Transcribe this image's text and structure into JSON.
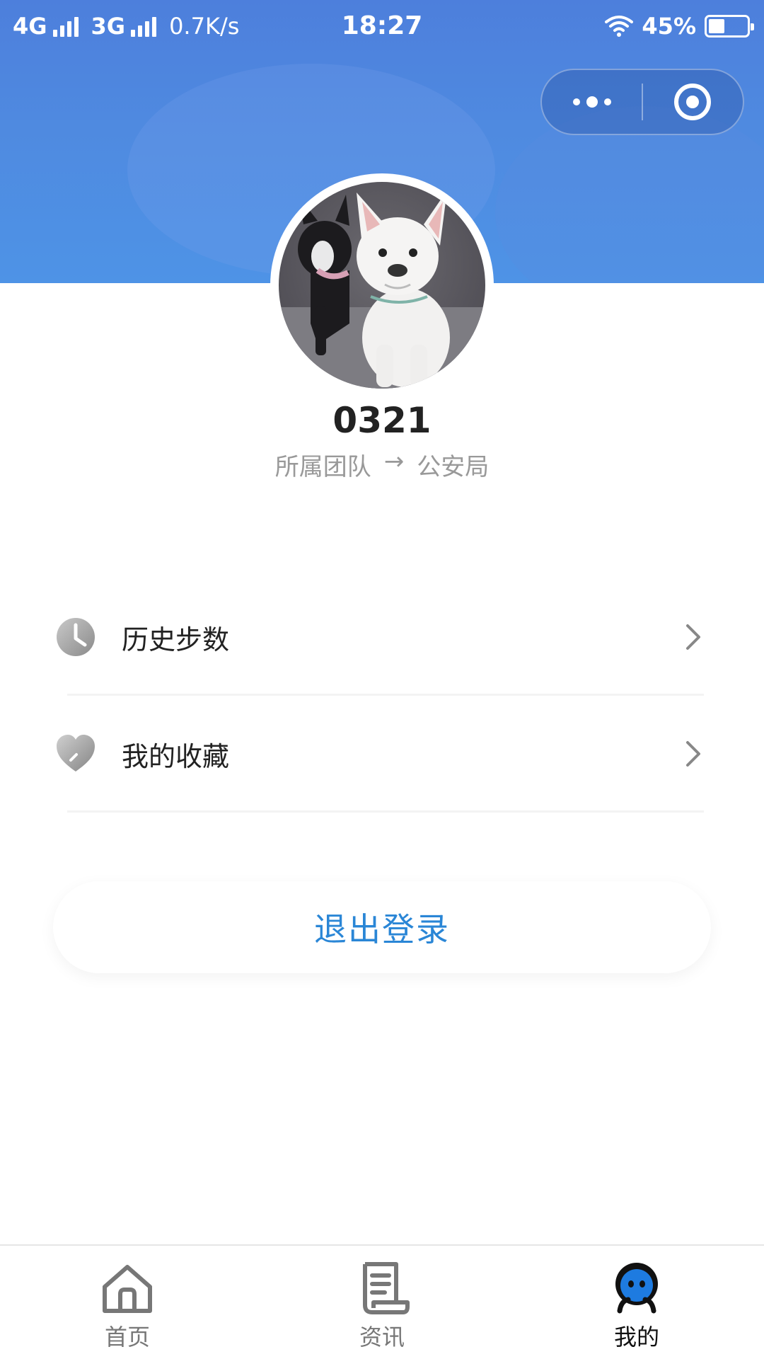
{
  "status_bar": {
    "network1": "4G",
    "network2": "3G",
    "speed": "0.7K/s",
    "time": "18:27",
    "battery": "45%"
  },
  "capsule": {
    "more_icon": "more-dots-icon",
    "close_icon": "target-close-icon"
  },
  "profile": {
    "username": "0321",
    "team_label": "所属团队",
    "team_arrow": "→",
    "team_name": "公安局"
  },
  "menu": {
    "items": [
      {
        "label": "历史步数",
        "icon": "clock-icon"
      },
      {
        "label": "我的收藏",
        "icon": "heart-icon"
      }
    ]
  },
  "logout": {
    "label": "退出登录"
  },
  "tabs": [
    {
      "label": "首页",
      "icon": "home-icon",
      "active": false
    },
    {
      "label": "资讯",
      "icon": "news-icon",
      "active": false
    },
    {
      "label": "我的",
      "icon": "profile-icon",
      "active": true
    }
  ],
  "colors": {
    "header_blue": "#4e8ae0",
    "accent_blue": "#2a86d6",
    "profile_tab_blue": "#1e7be0"
  }
}
